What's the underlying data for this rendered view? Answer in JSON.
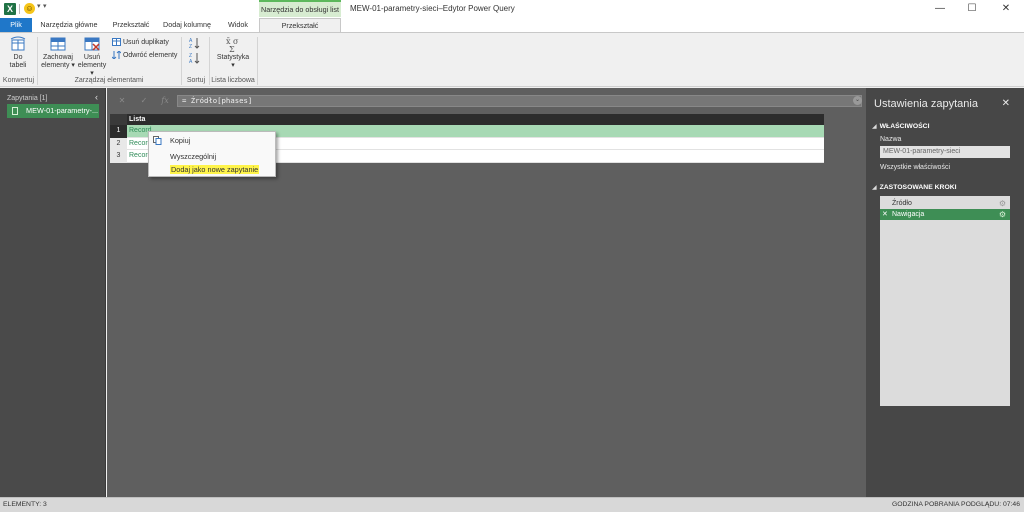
{
  "titlebar": {
    "app_icon": "X",
    "contextual_tab_group": "Narzędzia do obsługi list",
    "window_title": "MEW-01-parametry-sieci–Edytor Power Query",
    "minimize": "—",
    "maximize": "☐",
    "close": "✕"
  },
  "tabs": {
    "file": "Plik",
    "home": "Narzędzia główne",
    "transform": "Przekształć",
    "add_column": "Dodaj kolumnę",
    "view": "Widok",
    "context_transform": "Przekształć"
  },
  "ribbon": {
    "to_table_line1": "Do",
    "to_table_line2": "tabeli",
    "group_convert": "Konwertuj",
    "keep_items_line1": "Zachowaj",
    "keep_items_line2": "elementy",
    "remove_items_line1": "Usuń",
    "remove_items_line2": "elementy",
    "remove_duplicates": "Usuń duplikaty",
    "reverse_items": "Odwróć elementy",
    "group_manage": "Zarządzaj elementami",
    "group_sort": "Sortuj",
    "statistics": "Statystyka",
    "group_numeric": "Lista liczbowa"
  },
  "queries": {
    "header": "Zapytania [1]",
    "items": [
      {
        "label": "MEW-01-parametry-..."
      }
    ]
  },
  "formula": {
    "cancel": "✕",
    "confirm": "✓",
    "fx": "fx",
    "expression": "= Źródło[phases]"
  },
  "table": {
    "column": "Lista",
    "rows": [
      {
        "num": "1",
        "value": "Record"
      },
      {
        "num": "2",
        "value": "Record"
      },
      {
        "num": "3",
        "value": "Record"
      }
    ]
  },
  "context_menu": {
    "items": [
      {
        "label": "Kopiuj"
      },
      {
        "label": "Wyszczególnij"
      },
      {
        "label": "Dodaj jako nowe zapytanie"
      }
    ]
  },
  "settings": {
    "title": "Ustawienia zapytania",
    "properties_header": "WŁAŚCIWOŚCI",
    "name_label": "Nazwa",
    "name_value": "MEW-01-parametry-sieci",
    "all_properties": "Wszystkie właściwości",
    "steps_header": "ZASTOSOWANE KROKI",
    "steps": [
      {
        "label": "Źródło"
      },
      {
        "label": "Nawigacja"
      }
    ]
  },
  "status": {
    "left": "ELEMENTY: 3",
    "right": "GODZINA POBRANIA PODGLĄDU: 07:46"
  },
  "colors": {
    "accent_green": "#3e8e55",
    "file_tab_blue": "#1f77c9",
    "highlight_yellow": "#fff44a"
  }
}
